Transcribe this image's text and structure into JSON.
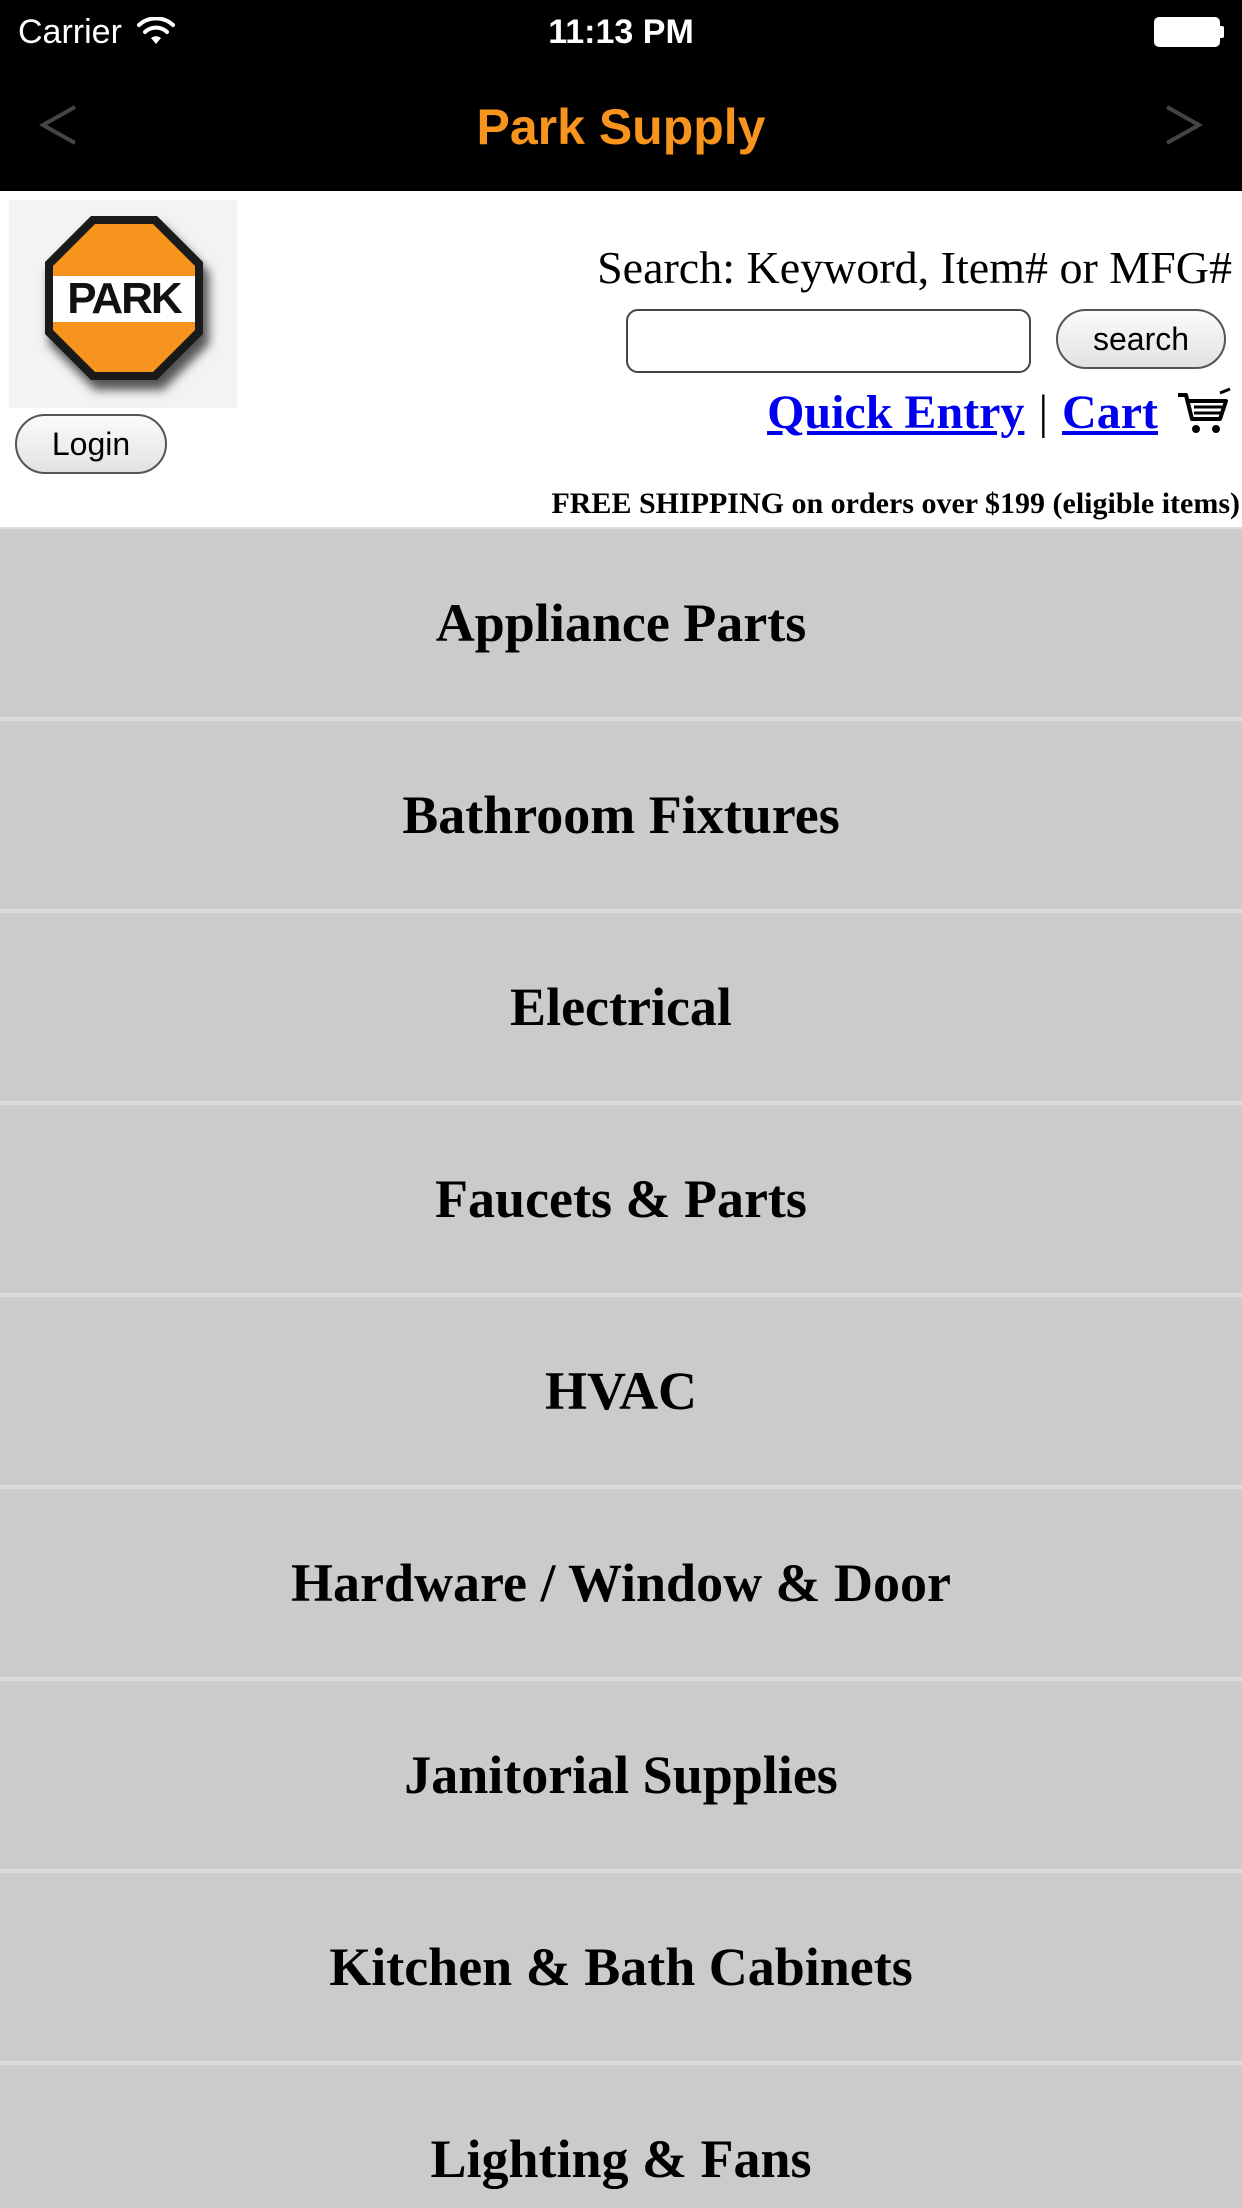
{
  "status_bar": {
    "carrier": "Carrier",
    "time": "11:13 PM",
    "icons": [
      "wifi-icon",
      "battery-icon"
    ]
  },
  "nav": {
    "title": "Park Supply",
    "back_glyph": "<",
    "forward_glyph": ">",
    "title_color": "#f7941d"
  },
  "header": {
    "logo_text": "PARK",
    "login_label": "Login",
    "search_label": "Search: Keyword, Item# or MFG#",
    "search_value": "",
    "search_button_label": "search",
    "quick_entry_label": "Quick Entry",
    "separator": "|",
    "cart_label": "Cart",
    "shipping_notice": "FREE SHIPPING on orders over $199 (eligible items)"
  },
  "categories": [
    "Appliance Parts",
    "Bathroom Fixtures",
    "Electrical",
    "Faucets & Parts",
    "HVAC",
    "Hardware / Window & Door",
    "Janitorial Supplies",
    "Kitchen & Bath Cabinets",
    "Lighting & Fans"
  ],
  "colors": {
    "topbar_bg": "#000000",
    "accent": "#f7941d",
    "link": "#0000ee",
    "category_bg": "#cbcbcb"
  }
}
